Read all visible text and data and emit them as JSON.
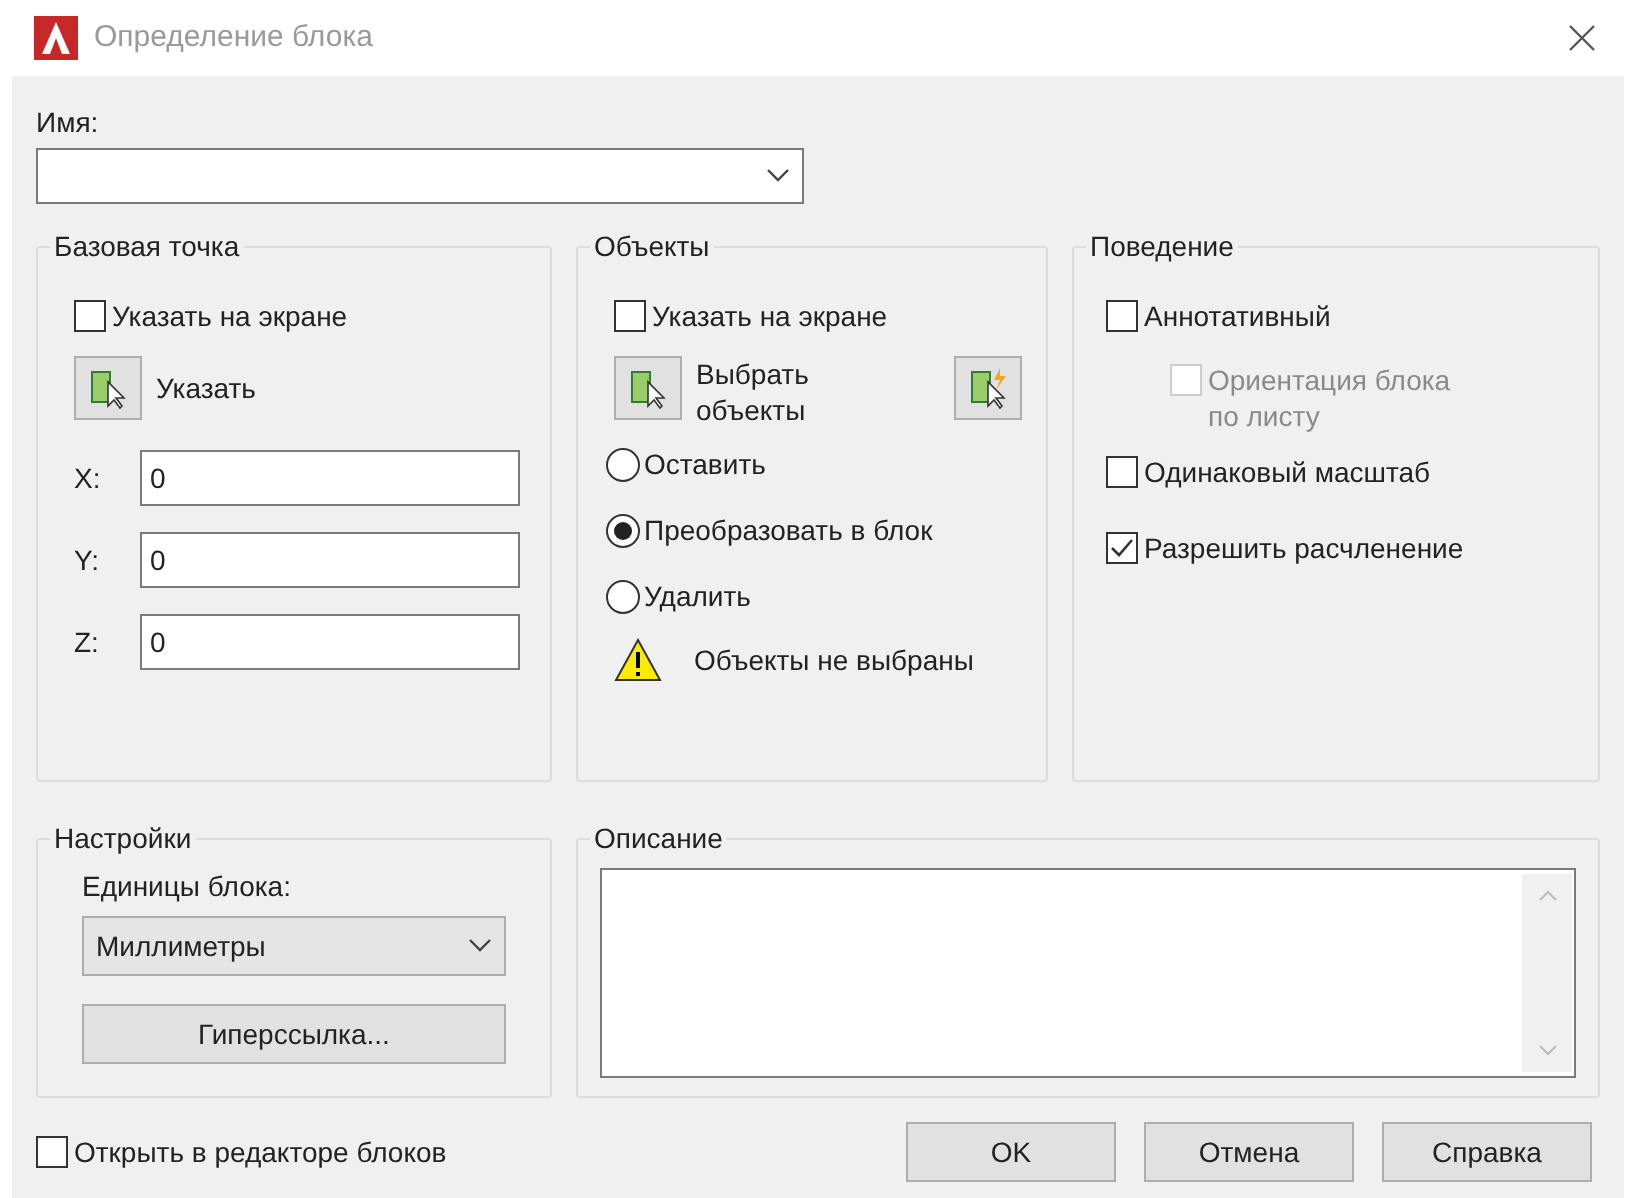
{
  "window": {
    "title": "Определение блока"
  },
  "name_field": {
    "label": "Имя:"
  },
  "base_point": {
    "title": "Базовая точка",
    "on_screen": {
      "label": "Указать на экране",
      "checked": false
    },
    "pick_button": "Указать",
    "coords": [
      {
        "label": "X:",
        "value": "0"
      },
      {
        "label": "Y:",
        "value": "0"
      },
      {
        "label": "Z:",
        "value": "0"
      }
    ]
  },
  "objects": {
    "title": "Объекты",
    "on_screen": {
      "label": "Указать на экране",
      "checked": false
    },
    "select_button": "Выбрать объекты",
    "options": [
      {
        "label": "Оставить",
        "selected": false
      },
      {
        "label": "Преобразовать в блок",
        "selected": true
      },
      {
        "label": "Удалить",
        "selected": false
      }
    ],
    "warning": "Объекты не выбраны"
  },
  "behavior": {
    "title": "Поведение",
    "checkboxes": [
      {
        "label": "Аннотативный",
        "checked": false,
        "disabled": false,
        "children": [
          {
            "label": "Ориентация блока по листу",
            "checked": false,
            "disabled": true
          }
        ]
      },
      {
        "label": "Одинаковый масштаб",
        "checked": false,
        "disabled": false
      },
      {
        "label": "Разрешить расчленение",
        "checked": true,
        "disabled": false
      }
    ]
  },
  "settings": {
    "title": "Настройки",
    "units_label": "Единицы блока:",
    "units_value": "Миллиметры",
    "hyperlink_button": "Гиперссылка..."
  },
  "description": {
    "title": "Описание"
  },
  "open_in_editor": {
    "label": "Открыть в редакторе блоков",
    "checked": false
  },
  "buttons": [
    "OK",
    "Отмена",
    "Справка"
  ]
}
